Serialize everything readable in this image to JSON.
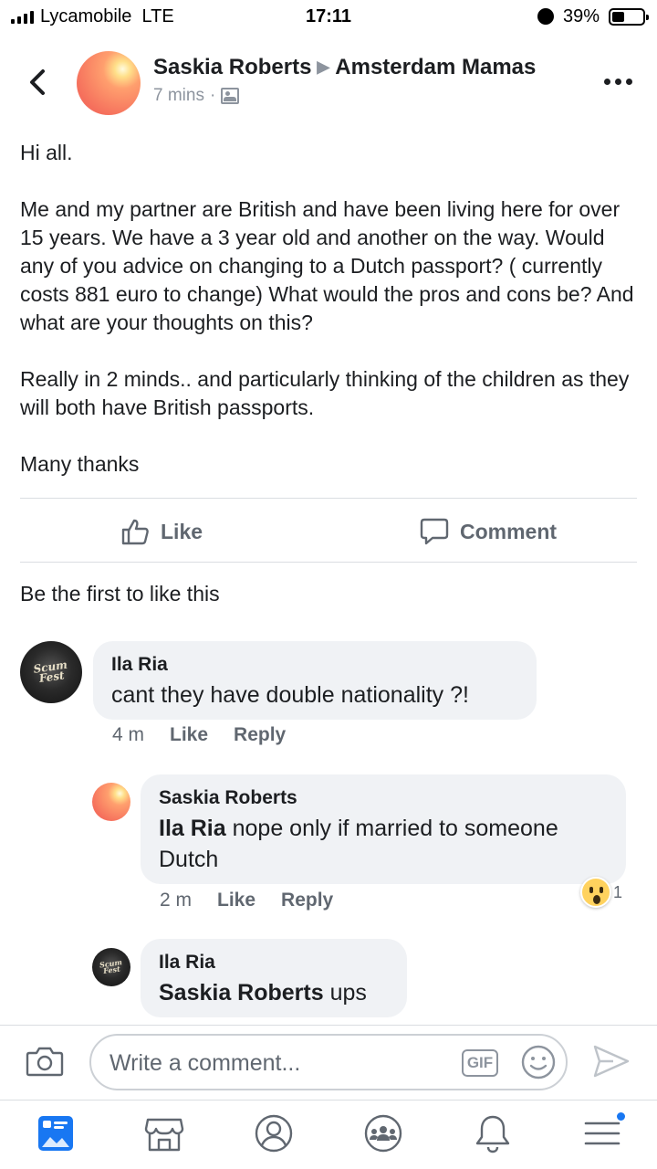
{
  "status_bar": {
    "carrier": "Lycamobile",
    "network": "LTE",
    "time": "17:11",
    "battery_percent": "39%",
    "battery_level": 0.39
  },
  "post": {
    "author": "Saskia Roberts",
    "group": "Amsterdam Mamas",
    "time": "7 mins",
    "separator": "·",
    "paragraphs": [
      "Hi all.",
      "Me and my partner are British and  have been living here for over 15 years. We have a 3 year old and another on the way. Would any of you advice on changing to a Dutch passport? ( currently costs 881 euro to change) What would the pros and cons be? And what are your thoughts on this?",
      "Really in 2 minds.. and particularly thinking of the children as they will both have British passports.",
      "Many thanks"
    ],
    "like_label": "Like",
    "comment_label": "Comment",
    "likes_summary": "Be the first to like this"
  },
  "comments": [
    {
      "author": "Ila Ria",
      "mention": "",
      "text": "cant they have double nationality ?!",
      "time": "4 m",
      "like_label": "Like",
      "reply_label": "Reply",
      "avatar_logo": "Scum Fest"
    },
    {
      "author": "Saskia Roberts",
      "mention": "Ila Ria",
      "text": " nope only if married to someone Dutch",
      "time": "2 m",
      "like_label": "Like",
      "reply_label": "Reply",
      "reaction_count": "1",
      "reaction_icon": "wow-reaction-icon"
    },
    {
      "author": "Ila Ria",
      "mention": "Saskia Roberts",
      "text": " ups",
      "avatar_logo": "Scum Fest"
    }
  ],
  "composer": {
    "placeholder": "Write a comment...",
    "gif_label": "GIF"
  },
  "tabs": [
    "news-feed-icon",
    "marketplace-icon",
    "profile-icon",
    "groups-icon",
    "notifications-icon",
    "menu-icon"
  ],
  "colors": {
    "accent": "#1877f2",
    "bubble": "#f0f2f5",
    "secondary_text": "#606770"
  }
}
